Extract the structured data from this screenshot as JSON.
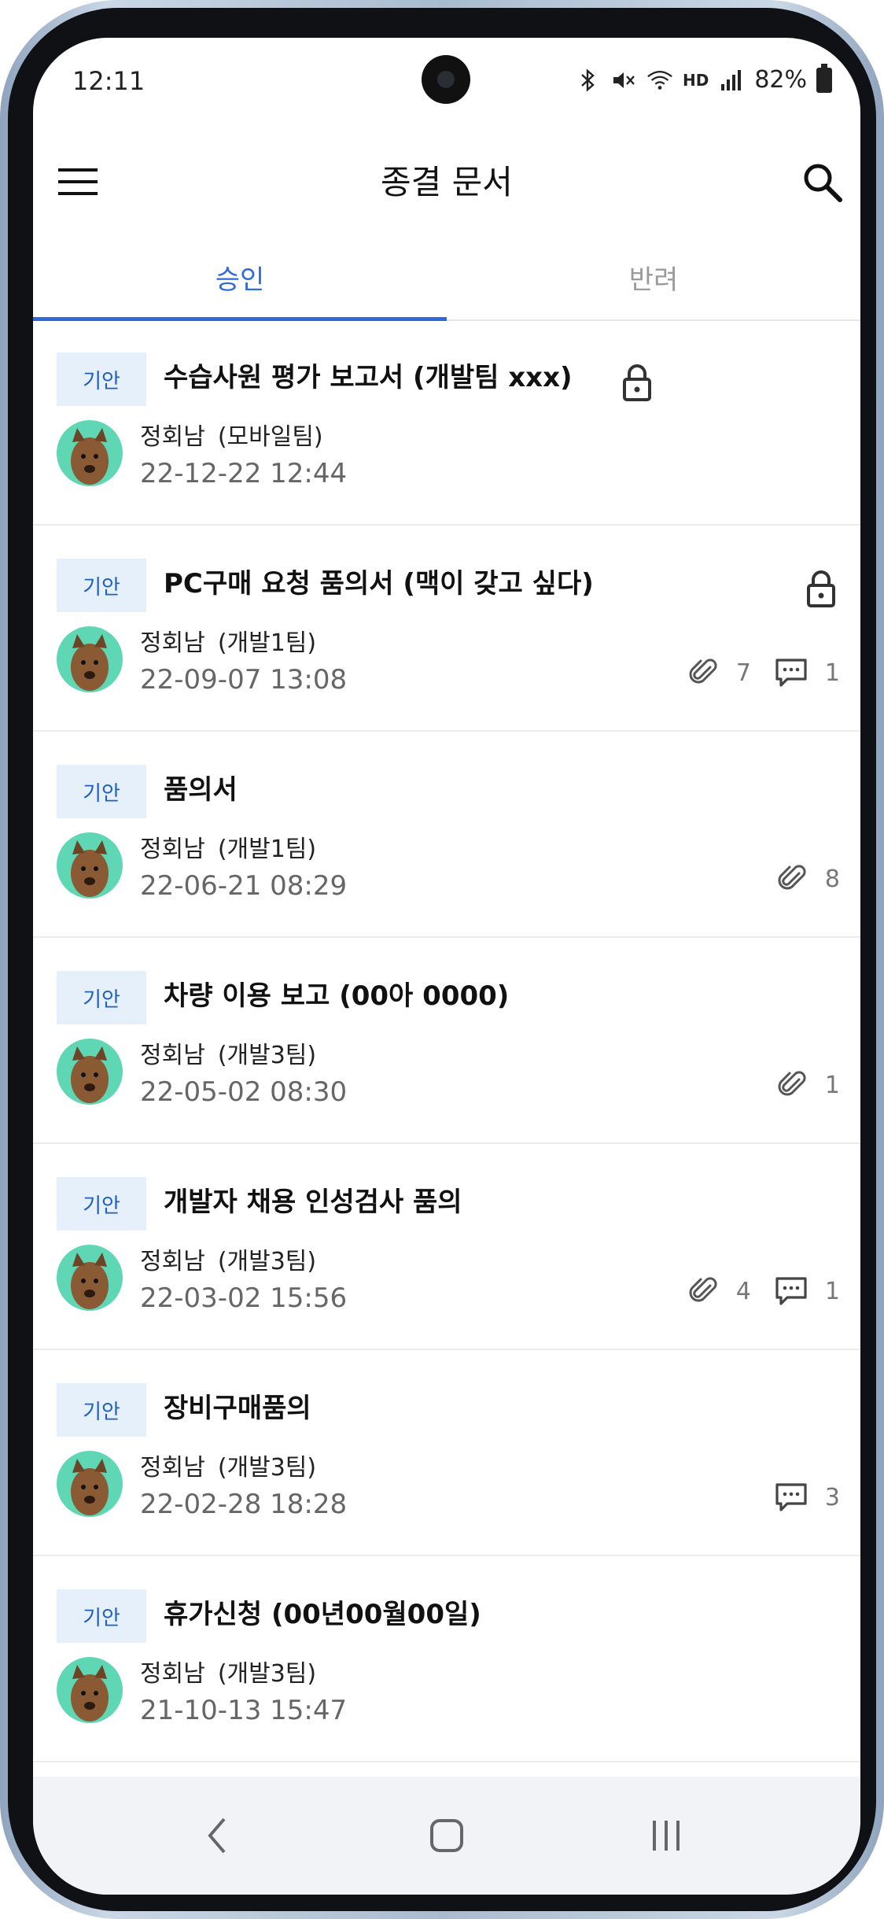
{
  "status_bar": {
    "time": "12:11",
    "battery": "82%",
    "network_label": "HD"
  },
  "appbar": {
    "title": "종결 문서"
  },
  "tabs": [
    {
      "label": "승인"
    },
    {
      "label": "반려"
    }
  ],
  "documents": [
    {
      "badge": "기안",
      "title": "수습사원 평가 보고서 (개발팀 xxx)",
      "author": "정회남",
      "team": "(모바일팀)",
      "date": "22-12-22 12:44",
      "locked": true
    },
    {
      "badge": "기안",
      "title": "PC구매 요청 품의서 (맥이 갖고 싶다)",
      "author": "정회남",
      "team": "(개발1팀)",
      "date": "22-09-07 13:08",
      "locked": true,
      "attachments": "7",
      "comments": "1"
    },
    {
      "badge": "기안",
      "title": "품의서",
      "author": "정회남",
      "team": "(개발1팀)",
      "date": "22-06-21 08:29",
      "attachments": "8"
    },
    {
      "badge": "기안",
      "title": "차량 이용 보고 (00아 0000)",
      "author": "정회남",
      "team": "(개발3팀)",
      "date": "22-05-02 08:30",
      "attachments": "1"
    },
    {
      "badge": "기안",
      "title": "개발자 채용 인성검사 품의",
      "author": "정회남",
      "team": "(개발3팀)",
      "date": "22-03-02 15:56",
      "attachments": "4",
      "comments": "1"
    },
    {
      "badge": "기안",
      "title": "장비구매품의",
      "author": "정회남",
      "team": "(개발3팀)",
      "date": "22-02-28 18:28",
      "comments": "3"
    },
    {
      "badge": "기안",
      "title": "휴가신청 (00년00월00일)",
      "author": "정회남",
      "team": "(개발3팀)",
      "date": "21-10-13 15:47"
    }
  ],
  "colors": {
    "accent": "#2e6bd8",
    "badge_bg": "#e6f0fb",
    "avatar_bg": "#5fd6b4"
  },
  "icons": [
    "menu-icon",
    "search-icon",
    "lock-icon",
    "paperclip-icon",
    "comment-icon",
    "back-icon",
    "home-icon",
    "recents-icon"
  ]
}
